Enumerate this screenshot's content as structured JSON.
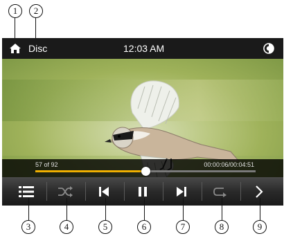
{
  "callouts": {
    "top": [
      "1",
      "2"
    ],
    "bottom": [
      "3",
      "4",
      "5",
      "6",
      "7",
      "8",
      "9"
    ]
  },
  "status_bar": {
    "source_label": "Disc",
    "clock": "12:03 AM",
    "home_icon": "home-icon",
    "brightness_icon": "brightness-icon"
  },
  "playback": {
    "track_counter": "57 of 92",
    "time_display": "00:00:06/00:04:51",
    "progress": 0.5
  },
  "controls": {
    "menu_icon": "menu-icon",
    "shuffle_icon": "shuffle-icon",
    "previous_icon": "skip-previous-icon",
    "pause_icon": "pause-icon",
    "next_icon": "skip-next-icon",
    "repeat_icon": "repeat-icon",
    "more_icon": "chevron-right-icon"
  },
  "colors": {
    "progress_fill": "#f0b000",
    "screen_bg": "#111111",
    "text": "#ffffff"
  }
}
